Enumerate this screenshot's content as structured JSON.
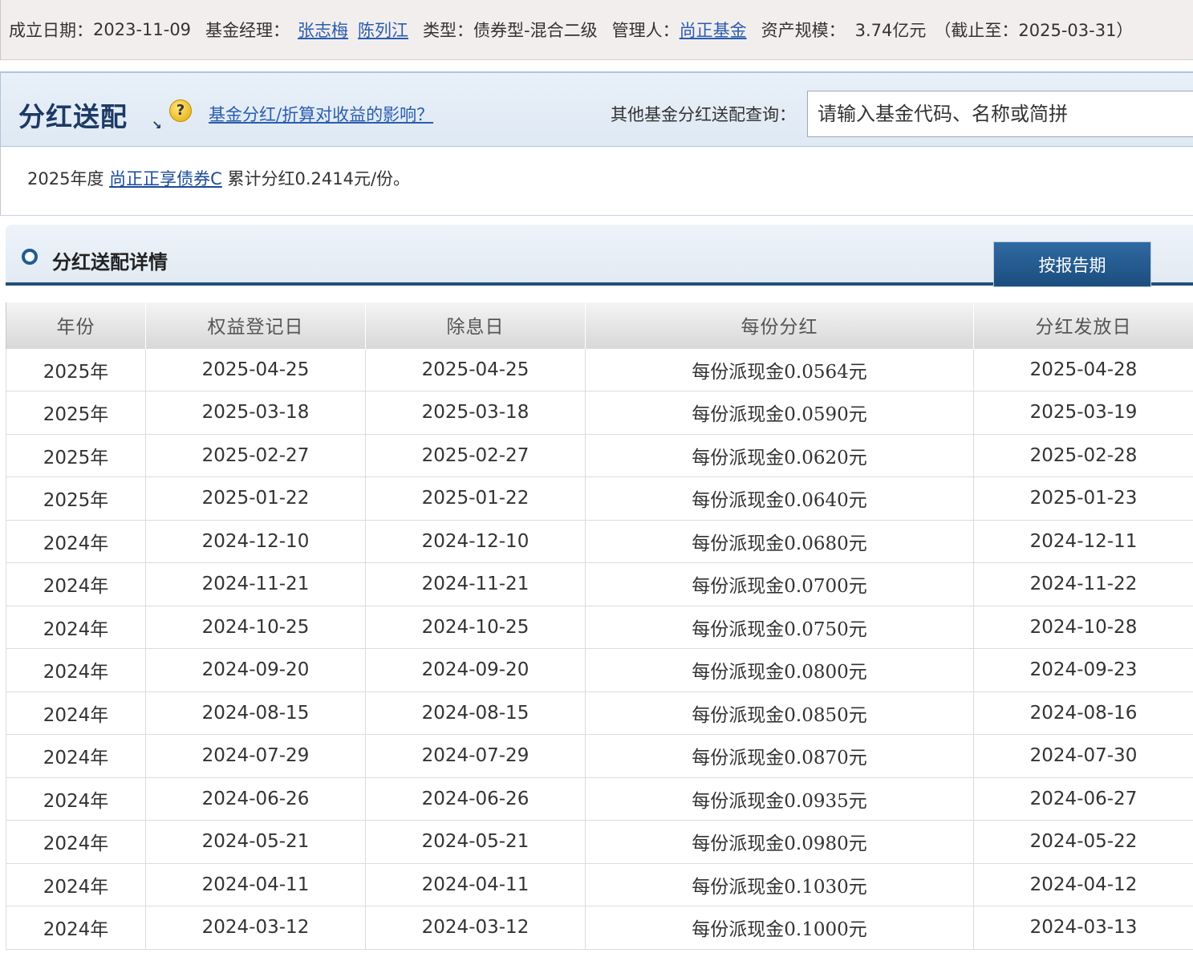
{
  "info": {
    "established_label": "成立日期：",
    "established_value": "2023-11-09",
    "manager_label": "基金经理：",
    "managers": [
      "张志梅",
      "陈列江"
    ],
    "type_label": "类型：",
    "type_value": "债券型-混合二级",
    "company_label": "管理人：",
    "company_value": "尚正基金",
    "size_label": "资产规模：",
    "size_value": "3.74亿元",
    "size_date": "（截止至：2025-03-31）"
  },
  "section": {
    "title": "分红送配",
    "arrow": "↘",
    "help_glyph": "?",
    "help_link": "基金分红/折算对收益的影响？",
    "search_label": "其他基金分红送配查询：",
    "search_placeholder": "请输入基金代码、名称或简拼"
  },
  "summary": {
    "year_text": "2025年度",
    "fund_name": "尚正正享债券C",
    "total_text": "累计分红0.2414元/份。"
  },
  "detail": {
    "title": "分红送配详情",
    "tab_label": "按报告期"
  },
  "table": {
    "headers": [
      "年份",
      "权益登记日",
      "除息日",
      "每份分红",
      "分红发放日"
    ],
    "rows": [
      [
        "2025年",
        "2025-04-25",
        "2025-04-25",
        "每份派现金0.0564元",
        "2025-04-28"
      ],
      [
        "2025年",
        "2025-03-18",
        "2025-03-18",
        "每份派现金0.0590元",
        "2025-03-19"
      ],
      [
        "2025年",
        "2025-02-27",
        "2025-02-27",
        "每份派现金0.0620元",
        "2025-02-28"
      ],
      [
        "2025年",
        "2025-01-22",
        "2025-01-22",
        "每份派现金0.0640元",
        "2025-01-23"
      ],
      [
        "2024年",
        "2024-12-10",
        "2024-12-10",
        "每份派现金0.0680元",
        "2024-12-11"
      ],
      [
        "2024年",
        "2024-11-21",
        "2024-11-21",
        "每份派现金0.0700元",
        "2024-11-22"
      ],
      [
        "2024年",
        "2024-10-25",
        "2024-10-25",
        "每份派现金0.0750元",
        "2024-10-28"
      ],
      [
        "2024年",
        "2024-09-20",
        "2024-09-20",
        "每份派现金0.0800元",
        "2024-09-23"
      ],
      [
        "2024年",
        "2024-08-15",
        "2024-08-15",
        "每份派现金0.0850元",
        "2024-08-16"
      ],
      [
        "2024年",
        "2024-07-29",
        "2024-07-29",
        "每份派现金0.0870元",
        "2024-07-30"
      ],
      [
        "2024年",
        "2024-06-26",
        "2024-06-26",
        "每份派现金0.0935元",
        "2024-06-27"
      ],
      [
        "2024年",
        "2024-05-21",
        "2024-05-21",
        "每份派现金0.0980元",
        "2024-05-22"
      ],
      [
        "2024年",
        "2024-04-11",
        "2024-04-11",
        "每份派现金0.1030元",
        "2024-04-12"
      ],
      [
        "2024年",
        "2024-03-12",
        "2024-03-12",
        "每份派现金0.1000元",
        "2024-03-13"
      ]
    ]
  }
}
